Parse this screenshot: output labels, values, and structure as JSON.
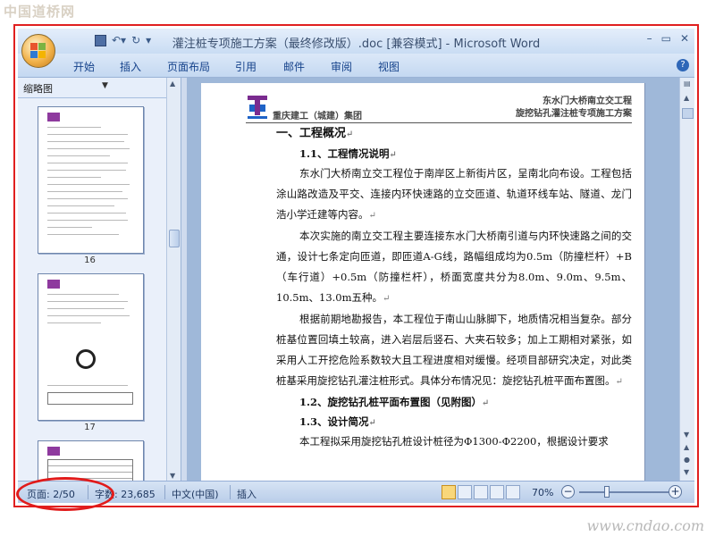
{
  "watermark_top": "中国道桥网",
  "watermark_bottom": "www.cndao.com",
  "window": {
    "title": "灌注桩专项施工方案（最终修改版）.doc [兼容模式] - Microsoft Word",
    "controls": {
      "minimize": "–",
      "restore": "▭",
      "close": "✕"
    }
  },
  "ribbon": {
    "tabs": [
      "开始",
      "插入",
      "页面布局",
      "引用",
      "邮件",
      "审阅",
      "视图"
    ],
    "help": "?"
  },
  "thumbnail_pane": {
    "title": "缩略图",
    "close": "×",
    "page_numbers": [
      "16",
      "17"
    ]
  },
  "document": {
    "header_left": "重庆建工（城建）集团",
    "header_right_1": "东水门大桥南立交工程",
    "header_right_2": "旋挖钻孔灌注桩专项施工方案",
    "heading_1": "一、工程概况",
    "heading_1_1": "1.1、工程情况说明",
    "para_1": "东水门大桥南立交工程位于南岸区上新街片区，呈南北向布设。工程包括涂山路改造及平交、连接内环快速路的立交匝道、轨道环线车站、隧道、龙门浩小学迁建等内容。",
    "para_2": "本次实施的南立交工程主要连接东水门大桥南引道与内环快速路之间的交通，设计七条定向匝道，即匝道A-G线，路幅组成均为0.5m（防撞栏杆）+B（车行道）+0.5m（防撞栏杆），桥面宽度共分为8.0m、9.0m、9.5m、10.5m、13.0m五种。",
    "para_3": "根据前期地勘报告，本工程位于南山山脉脚下，地质情况相当复杂。部分桩基位置回填土较高，进入岩层后竖石、大夹石较多；加上工期相对紧张，如采用人工开挖危险系数较大且工程进度相对缓慢。经项目部研究决定，对此类桩基采用旋挖钻孔灌注桩形式。具体分布情况见：旋挖钻孔桩平面布置图。",
    "heading_1_2": "1.2、旋挖钻孔桩平面布置图（见附图）",
    "heading_1_3": "1.3、设计简况",
    "para_4": "本工程拟采用旋挖钻孔桩设计桩径为Φ1300-Φ2200，根据设计要求",
    "para_mark": "↵"
  },
  "status_bar": {
    "page": "页面: 2/50",
    "words": "字数: 23,685",
    "language": "中文(中国)",
    "insert_mode": "插入",
    "zoom": "70%",
    "zoom_level": 0.7
  },
  "colors": {
    "highlight_outline": "#e02020",
    "ribbon_text": "#15428b",
    "logo_purple": "#7a2b8f",
    "logo_blue": "#1e63c7"
  }
}
